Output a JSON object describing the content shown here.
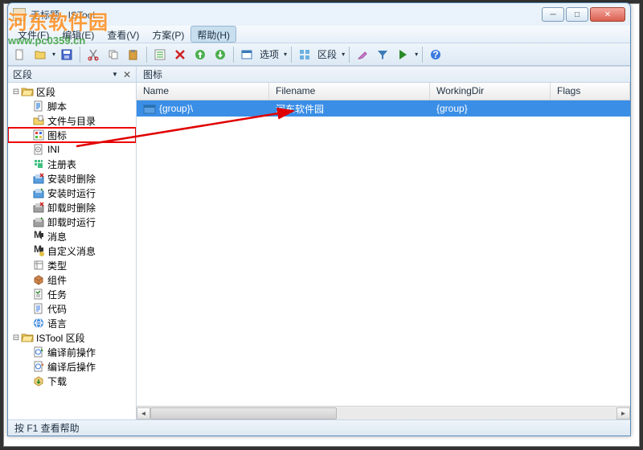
{
  "window": {
    "title": "无标题 - ISTool"
  },
  "menu": {
    "file": "文件(F)",
    "edit": "编辑(E)",
    "view": "查看(V)",
    "project": "方案(P)",
    "help": "帮助(H)"
  },
  "toolbar": {
    "options_label": "选项",
    "sections_label": "区段"
  },
  "sidebar": {
    "title": "区段",
    "root1": "区段",
    "items": [
      "脚本",
      "文件与目录",
      "图标",
      "INI",
      "注册表",
      "安装时删除",
      "安装时运行",
      "卸载时删除",
      "卸载时运行",
      "消息",
      "自定义消息",
      "类型",
      "组件",
      "任务",
      "代码",
      "语言"
    ],
    "root2": "ISTool 区段",
    "items2": [
      "编译前操作",
      "编译后操作",
      "下载"
    ]
  },
  "main": {
    "header": "图标",
    "columns": {
      "name": "Name",
      "filename": "Filename",
      "workingdir": "WorkingDir",
      "flags": "Flags"
    },
    "row": {
      "name": "{group}\\",
      "filename": "河东软件园",
      "workingdir": "{group}",
      "flags": ""
    }
  },
  "statusbar": {
    "text": "按 F1 查看帮助"
  },
  "watermark": {
    "name": "河东软件园",
    "url": "www.pc0359.cn"
  }
}
